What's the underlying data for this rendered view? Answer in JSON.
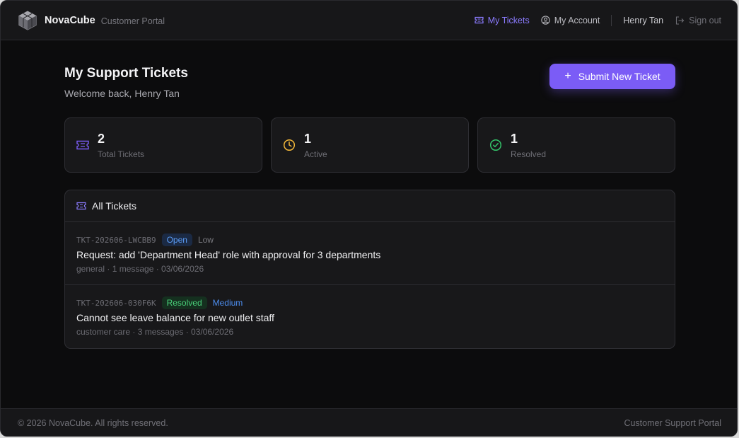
{
  "brand": {
    "name": "NovaCube",
    "subtitle": "Customer Portal"
  },
  "nav": {
    "my_tickets": "My Tickets",
    "my_account": "My Account",
    "user_name": "Henry Tan",
    "sign_out": "Sign out"
  },
  "page": {
    "title": "My Support Tickets",
    "welcome": "Welcome back, Henry Tan",
    "submit_label": "Submit New Ticket"
  },
  "stats": [
    {
      "value": "2",
      "label": "Total Tickets",
      "icon": "ticket-icon",
      "color": "#7b5cf6"
    },
    {
      "value": "1",
      "label": "Active",
      "icon": "clock-icon",
      "color": "#f5b93a"
    },
    {
      "value": "1",
      "label": "Resolved",
      "icon": "check-circle-icon",
      "color": "#34c46a"
    }
  ],
  "tickets_panel": {
    "title": "All Tickets",
    "tickets": [
      {
        "id": "TKT-202606-LWCBB9",
        "status": "Open",
        "priority": "Low",
        "title": "Request: add 'Department Head' role with approval for 3 departments",
        "meta": "general · 1 message · 03/06/2026"
      },
      {
        "id": "TKT-202606-030F6K",
        "status": "Resolved",
        "priority": "Medium",
        "title": "Cannot see leave balance for new outlet staff",
        "meta": "customer care · 3 messages · 03/06/2026"
      }
    ]
  },
  "footer": {
    "copyright": "© 2026 NovaCube. All rights reserved.",
    "right": "Customer Support Portal"
  },
  "colors": {
    "accent": "#7b5cf6",
    "open": "#5b9cf5",
    "resolved": "#4ad07a"
  }
}
